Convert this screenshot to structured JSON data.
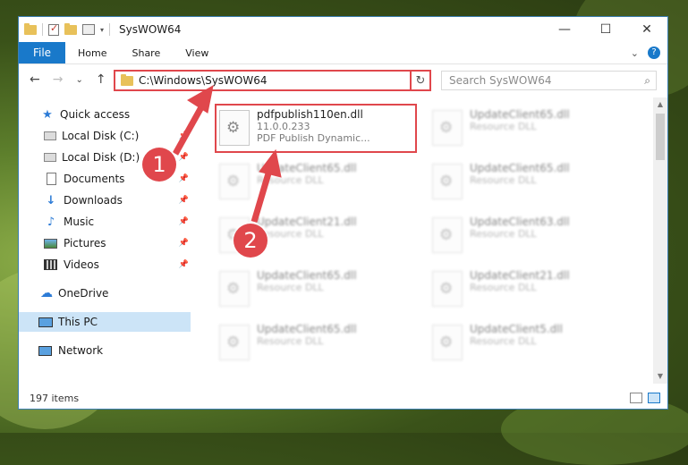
{
  "window": {
    "title": "SysWOW64",
    "controls": [
      "—",
      "☐",
      "✕"
    ]
  },
  "ribbon": {
    "file": "File",
    "tabs": [
      "Home",
      "Share",
      "View"
    ],
    "help": "?"
  },
  "nav": {
    "back": "←",
    "forward": "→",
    "recent": "⌄",
    "up": "↑"
  },
  "address": {
    "path": "C:\\Windows\\SysWOW64",
    "refresh": "↻"
  },
  "search": {
    "placeholder": "Search SysWOW64",
    "icon": "search-icon"
  },
  "sidebar": {
    "items": [
      {
        "label": "Quick access",
        "icon": "star-icon",
        "pinned": false
      },
      {
        "label": "Local Disk (C:)",
        "icon": "disk-icon",
        "pinned": true
      },
      {
        "label": "Local Disk (D:)",
        "icon": "disk-icon",
        "pinned": true
      },
      {
        "label": "Documents",
        "icon": "documents-icon",
        "pinned": true
      },
      {
        "label": "Downloads",
        "icon": "download-icon",
        "pinned": true
      },
      {
        "label": "Music",
        "icon": "music-icon",
        "pinned": true
      },
      {
        "label": "Pictures",
        "icon": "pictures-icon",
        "pinned": true
      },
      {
        "label": "Videos",
        "icon": "videos-icon",
        "pinned": true
      },
      {
        "label": "OneDrive",
        "icon": "cloud-icon",
        "pinned": false
      },
      {
        "label": "This PC",
        "icon": "computer-icon",
        "pinned": false,
        "selected": true
      },
      {
        "label": "Network",
        "icon": "network-icon",
        "pinned": false
      }
    ]
  },
  "files": [
    {
      "name": "pdfpublish110en.dll",
      "line2": "11.0.0.233",
      "line3": "PDF Publish Dynamic...",
      "highlighted": true
    },
    {
      "name": "UpdateClient65.dll",
      "line2": "Resource DLL"
    },
    {
      "name": "UpdateClient65.dll",
      "line2": "Resource DLL"
    },
    {
      "name": "UpdateClient65.dll",
      "line2": "Resource DLL"
    },
    {
      "name": "UpdateClient21.dll",
      "line2": "Resource DLL"
    },
    {
      "name": "UpdateClient63.dll",
      "line2": "Resource DLL"
    },
    {
      "name": "UpdateClient65.dll",
      "line2": "Resource DLL"
    },
    {
      "name": "UpdateClient21.dll",
      "line2": "Resource DLL"
    },
    {
      "name": "UpdateClient65.dll",
      "line2": "Resource DLL"
    },
    {
      "name": "UpdateClient5.dll",
      "line2": "Resource DLL"
    }
  ],
  "status": {
    "count": "197 items"
  },
  "annotations": {
    "step1": "1",
    "step2": "2",
    "color": "#e0474c"
  }
}
